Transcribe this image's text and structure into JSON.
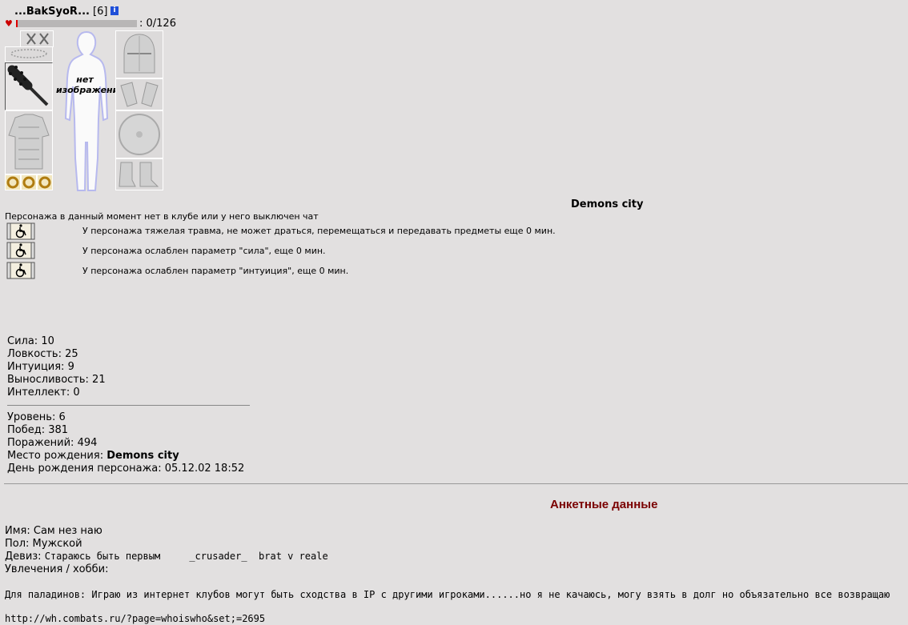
{
  "header": {
    "name": "...BakSyoR...",
    "level": "[6]",
    "info_icon": "i",
    "hp_text": ": 0/126",
    "hp_fraction": 0.0
  },
  "avatar": {
    "no_image_text_1": "нет",
    "no_image_text_2": "изображения"
  },
  "equipment": {
    "slots": [
      "crossed-swords-icon",
      "amulet-icon",
      "club-weapon-icon",
      "armor-icon",
      "ring-icon",
      "helmet-icon",
      "gauntlets-icon",
      "shield-icon",
      "boots-icon"
    ]
  },
  "city": "Demons city",
  "status": {
    "offline": "Персонажа в данный момент нет в клубе или у него выключен чат",
    "effects": [
      "У персонажа тяжелая травма, не может драться, перемещаться и передавать предметы еще 0 мин.",
      "У персонажа ослаблен параметр \"сила\", еще 0 мин.",
      "У персонажа ослаблен параметр \"интуиция\", еще 0 мин."
    ]
  },
  "stats": {
    "strength": "Сила: 10",
    "agility": "Ловкость: 25",
    "intuition": "Интуиция: 9",
    "endurance": "Выносливость: 21",
    "intellect": "Интеллект: 0"
  },
  "record": {
    "level": "Уровень: 6",
    "wins": "Побед: 381",
    "losses": "Поражений: 494",
    "birthplace_label": "Место рождения: ",
    "birthplace_value": "Demons city",
    "birthday": "День рождения персонажа: 05.12.02 18:52"
  },
  "profile": {
    "title": "Анкетные данные",
    "name": "Имя: Сам нез наю",
    "gender": "Пол: Мужской",
    "motto_label": "Девиз: ",
    "motto_value": "Стараюсь быть первым     _crusader_  brat v reale",
    "hobby": "Увлечения / хобби:",
    "paladins": "Для паладинов: Играю из интернет клубов могут быть сходства в IP с другими игроками......но я не качаюсь, могу взять в долг но объязательно все возвращаю",
    "link": "http://wh.combats.ru/?page=whoiswho&set;=2695"
  }
}
